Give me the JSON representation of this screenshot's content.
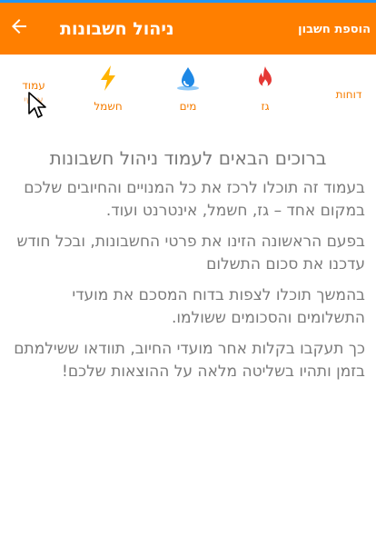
{
  "header": {
    "title": "ניהול חשבונות",
    "add_account_label": "הוספת חשבון"
  },
  "nav": {
    "items": [
      {
        "label": "דוחות",
        "icon": "reports"
      },
      {
        "label": "גז",
        "icon": "flame-icon"
      },
      {
        "label": "מים",
        "icon": "water-drop-icon"
      },
      {
        "label": "חשמל",
        "icon": "lightning-icon"
      },
      {
        "label_line1": "עמוד",
        "label_line2": "אישי",
        "icon": "none"
      }
    ]
  },
  "content": {
    "welcome": "ברוכים הבאים לעמוד ניהול חשבונות",
    "paragraphs": [
      "בעמוד זה תוכלו לרכז את כל המנויים והחיובים שלכם במקום אחד – גז, חשמל, אינטרנט ועוד.",
      "בפעם הראשונה הזינו את פרטי החשבונות, ובכל חודש עדכנו את סכום התשלום",
      "בהמשך תוכלו לצפות בדוח המסכם את מועדי התשלומים והסכומים ששולמו.",
      "כך תעקבו בקלות אחר מועדי החיוב, תוודאו ששילמתם בזמן ותהיו בשליטה מלאה על ההוצאות שלכם!"
    ]
  },
  "colors": {
    "appbar": "#ff7f00",
    "accent_text": "#f57c00",
    "flame": "#e53935",
    "water": "#1e88e5",
    "lightning": "#ffb300",
    "body_text": "#7a7a7a"
  }
}
